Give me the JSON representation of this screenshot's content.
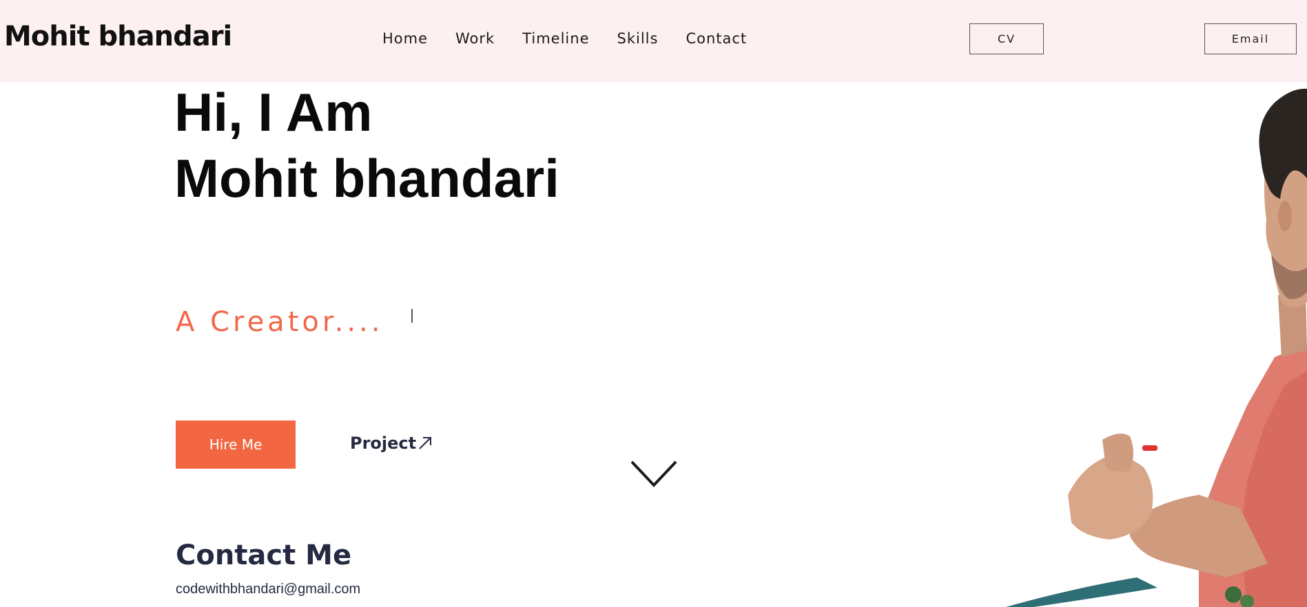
{
  "header": {
    "brand": "Mohit bhandari",
    "nav": [
      {
        "label": "Home"
      },
      {
        "label": "Work"
      },
      {
        "label": "Timeline"
      },
      {
        "label": "Skills"
      },
      {
        "label": "Contact"
      }
    ],
    "cv_label": "CV",
    "email_label": "Email"
  },
  "hero": {
    "greeting": "Hi, I Am",
    "name": "Mohit bhandari",
    "tagline": "A Creator....",
    "hire_label": "Hire Me",
    "project_label": "Project",
    "project_icon": "arrow-up-right-icon",
    "scroll_icon": "chevron-down-icon"
  },
  "contact": {
    "title": "Contact Me",
    "email": "codewithbhandari@gmail.com"
  },
  "colors": {
    "header_bg": "#fdf0f0",
    "accent": "#f26641",
    "tagline": "#f06749",
    "heading_dark": "#252a42"
  }
}
